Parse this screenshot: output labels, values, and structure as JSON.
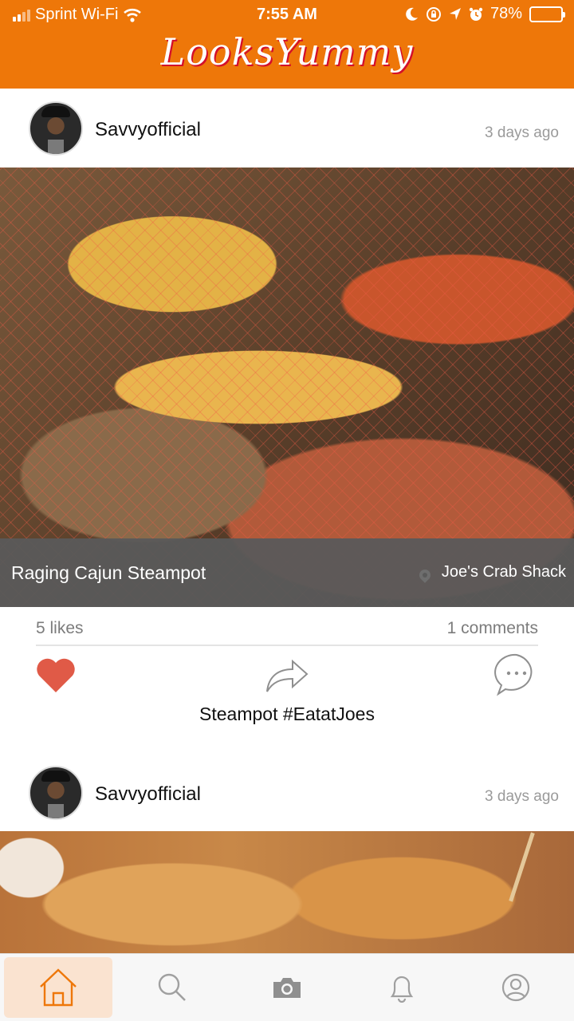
{
  "status_bar": {
    "carrier": "Sprint Wi-Fi",
    "time": "7:55 AM",
    "battery_percent": "78%",
    "battery_level": 0.78,
    "icons": [
      "signal-icon",
      "wifi-icon",
      "moon-icon",
      "rotation-lock-icon",
      "location-icon",
      "alarm-icon",
      "battery-icon"
    ]
  },
  "header": {
    "logo_text": "LooksYummy",
    "colors": {
      "bar": "#ee7709",
      "logo_shadow": "#d40f2a"
    }
  },
  "posts": [
    {
      "username": "Savvyofficial",
      "time_ago": "3 days ago",
      "dish_name": "Raging Cajun Steampot",
      "location": "Joe's Crab Shack",
      "likes": "5 likes",
      "comments": "1 comments",
      "caption": "Steampot #EatatJoes",
      "liked": true,
      "heart_color": "#e05a47"
    },
    {
      "username": "Savvyofficial",
      "time_ago": "3 days ago"
    }
  ],
  "tabbar": {
    "active": "home",
    "tabs": [
      "home-icon",
      "search-icon",
      "camera-icon",
      "bell-icon",
      "profile-icon"
    ],
    "active_color": "#ee7709",
    "inactive_color": "#9a9a9a"
  }
}
